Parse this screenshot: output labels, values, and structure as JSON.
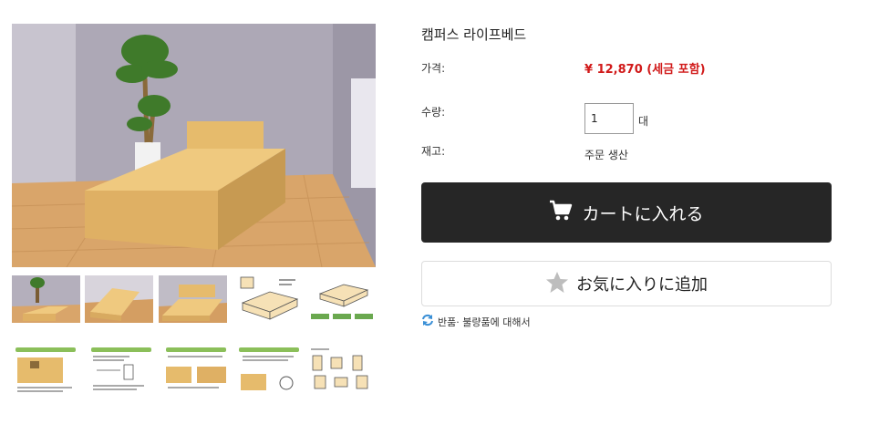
{
  "product": {
    "title": "캠퍼스 라이프베드",
    "price_label": "가격:",
    "price_value": "¥ 12,870 (세금 포함)",
    "quantity_label": "수량:",
    "quantity_value": "1",
    "quantity_unit": "대",
    "stock_label": "재고:",
    "stock_value": "주문 생산"
  },
  "actions": {
    "add_to_cart": "カートに入れる",
    "add_to_favorites": "お気に入りに追加",
    "returns_link": "반품· 불량품에 대해서"
  },
  "colors": {
    "price": "#d11a1a",
    "cart_button_bg": "#262626",
    "returns_icon": "#3a8fd6",
    "favorite_star": "#bdbdbd"
  },
  "icons": {
    "cart": "cart-icon",
    "favorite": "star-icon",
    "returns": "refresh-icon"
  }
}
